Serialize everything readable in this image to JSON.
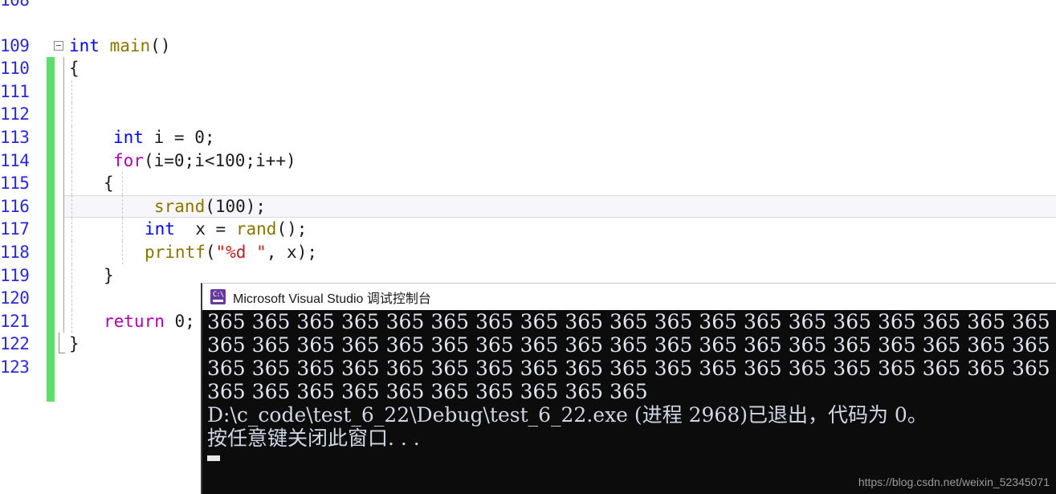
{
  "editor": {
    "lines": [
      {
        "num": "108",
        "text": "",
        "partial": true,
        "changed": true,
        "indent_guides": []
      },
      {
        "num": "109",
        "text": "",
        "changed": true,
        "indent_guides": []
      },
      {
        "num": "110",
        "text": "int main()",
        "changed": true,
        "fold": "collapse",
        "indent_guides": []
      },
      {
        "num": "111",
        "text": "{",
        "changed": true,
        "indent_guides": []
      },
      {
        "num": "112",
        "text": "",
        "changed": true,
        "indent_guides": [
          "dg1"
        ]
      },
      {
        "num": "113",
        "text": "",
        "changed": true,
        "indent_guides": [
          "dg1"
        ]
      },
      {
        "num": "114",
        "text": "    int i = 0;",
        "changed": true,
        "indent_guides": [
          "dg1"
        ]
      },
      {
        "num": "115",
        "text": "    for(i=0;i<100;i++)",
        "changed": true,
        "indent_guides": [
          "dg1"
        ]
      },
      {
        "num": "116",
        "text": "    {",
        "changed": true,
        "indent_guides": [
          "dg1",
          "dg2"
        ]
      },
      {
        "num": "117",
        "text": "        srand(100);",
        "changed": true,
        "current": true,
        "indent_guides": [
          "dg1",
          "dg2"
        ]
      },
      {
        "num": "118",
        "text": "        int  x = rand();",
        "changed": true,
        "indent_guides": [
          "dg1",
          "dg2"
        ]
      },
      {
        "num": "119",
        "text": "        printf(\"%d \", x);",
        "changed": true,
        "indent_guides": [
          "dg1",
          "dg2"
        ]
      },
      {
        "num": "120",
        "text": "    }",
        "changed": true,
        "indent_guides": [
          "dg1"
        ]
      },
      {
        "num": "121",
        "text": "",
        "changed": true,
        "indent_guides": [
          "dg1"
        ]
      },
      {
        "num": "122",
        "text": "    return 0;",
        "changed": true,
        "indent_guides": [
          "dg1"
        ]
      },
      {
        "num": "123",
        "text": "}",
        "changed": true,
        "fold": "end",
        "indent_guides": []
      }
    ]
  },
  "console": {
    "title": "Microsoft Visual Studio 调试控制台",
    "icon_name": "console-app-icon",
    "icon_text": "C:\\",
    "output_value": "365",
    "output_rows": [
      "365 365 365 365 365 365 365 365 365 365 365 365 365 365 365 365 365 365 365",
      "365 365 365 365 365 365 365 365 365 365 365 365 365 365 365 365 365 365 365",
      "365 365 365 365 365 365 365 365 365 365 365 365 365 365 365 365 365 365 365",
      "365 365 365 365 365 365 365 365 365 365"
    ],
    "exit_line": "D:\\c_code\\test_6_22\\Debug\\test_6_22.exe (进程 2968)已退出，代码为 0。",
    "prompt_line": "按任意键关闭此窗口. . ."
  },
  "watermark": "https://blog.csdn.net/weixin_52345071"
}
